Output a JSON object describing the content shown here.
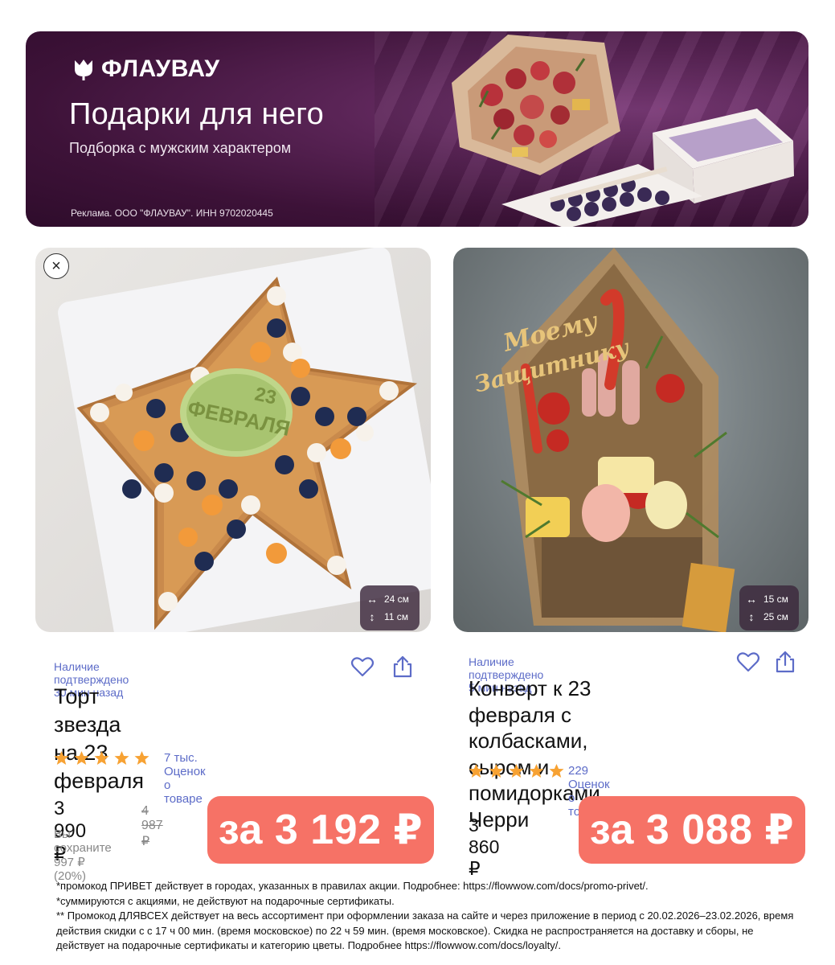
{
  "banner": {
    "brand": "ФЛАУВАУ",
    "title": "Подарки для него",
    "subtitle": "Подборка с мужским характером",
    "ad_note": "Реклама. ООО \"ФЛАУВАУ\". ИНН 9702020445",
    "bg_color": "#3d1238"
  },
  "cards": [
    {
      "availability": "Наличие подтверждено 30 мин назад",
      "title_line1": "Торт звезда на 23",
      "title_line2": "февраля",
      "rating": 5,
      "reviews": "7 тыс. Оценок о товаре",
      "price": "3 990 ₽",
      "old_price": "4 987 ₽",
      "save_note": "Вы сохраните 997 ₽  (20%)",
      "promo_price": "за 3 192 ₽",
      "width_dim": "24 см",
      "height_dim": "11 см",
      "cake_label_num": "23",
      "cake_label_word": "ФЕВРАЛЯ"
    },
    {
      "availability": "Наличие подтверждено 5 мин назад",
      "title_line1": "Конверт к 23 февраля с",
      "title_line2": "колбасками, сыром и",
      "title_line3": "помидорками Черри",
      "rating": 5,
      "reviews": "229 Оценок о товаре",
      "price": "3 860 ₽",
      "promo_price": "за 3 088 ₽",
      "width_dim": "15 см",
      "height_dim": "25 см",
      "topper_line1": "Моему",
      "topper_line2": "Защитнику"
    }
  ],
  "colors": {
    "accent": "#5d6cc8",
    "promo": "#f67266",
    "star": "#f7a233"
  },
  "footnotes": [
    "*промокод ПРИВЕТ действует в городах, указанных в правилах акции. Подробнее: https://flowwow.com/docs/promo-privet/.",
    "*суммируются с акциями, не действуют на подарочные сертификаты.",
    "** Промокод ДЛЯВСЕХ действует на весь ассортимент при оформлении заказа на сайте и через приложение в период с 20.02.2026–23.02.2026, время действия скидки с с 17 ч 00 мин. (время московское) по 22 ч 59 мин. (время московское). Скидка не распространяется на доставку и сборы, не действует на подарочные сертификаты и категорию цветы. Подробнее https://flowwow.com/docs/loyalty/."
  ]
}
